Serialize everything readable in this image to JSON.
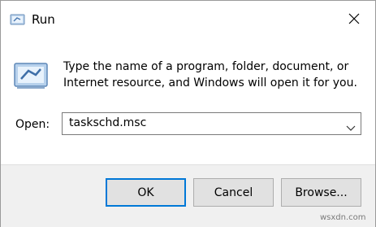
{
  "window": {
    "title": "Run"
  },
  "icons": {
    "app": "run-icon",
    "close": "close-icon",
    "big": "run-large-icon",
    "dropdown": "chevron-down-icon"
  },
  "message": "Type the name of a program, folder, document, or Internet resource, and Windows will open it for you.",
  "open": {
    "label": "Open:",
    "value": "taskschd.msc"
  },
  "buttons": {
    "ok": "OK",
    "cancel": "Cancel",
    "browse": "Browse..."
  },
  "watermark": "wsxdn.com",
  "colors": {
    "accent": "#0078d7",
    "footer_bg": "#f0f0f0",
    "button_bg": "#e1e1e1"
  }
}
